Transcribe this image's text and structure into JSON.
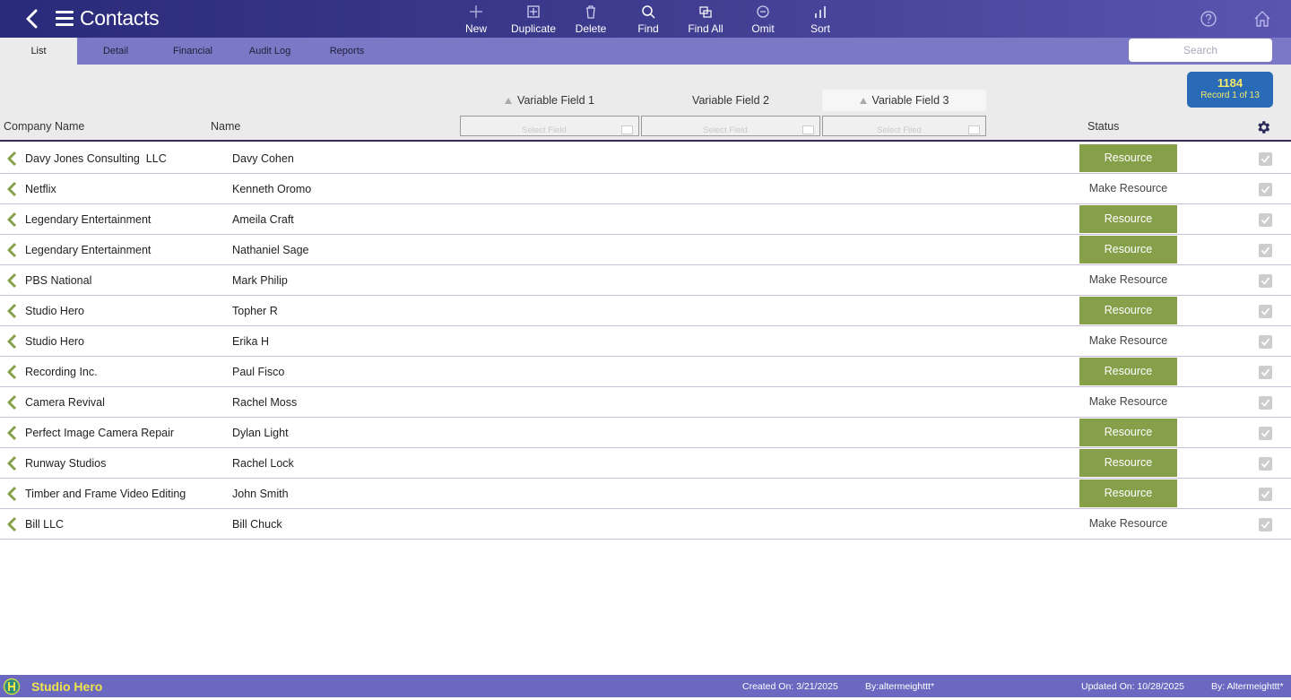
{
  "app": {
    "title": "Contacts",
    "icons": {
      "back": "chevron-left-icon",
      "menu": "hamburger-menu-icon",
      "help": "help-circle-icon",
      "home": "home-icon"
    }
  },
  "toolbar": {
    "new": "New",
    "duplicate": "Duplicate",
    "delete": "Delete",
    "find": "Find",
    "find_all": "Find All",
    "omit": "Omit",
    "sort": "Sort"
  },
  "tabs": [
    {
      "label": "List",
      "active": true
    },
    {
      "label": "Detail",
      "active": false
    },
    {
      "label": "Financial",
      "active": false
    },
    {
      "label": "Audit Log",
      "active": false
    },
    {
      "label": "Reports",
      "active": false
    }
  ],
  "search": {
    "placeholder": "Search"
  },
  "record_info": {
    "count": "1184",
    "position": "Record 1 of 13"
  },
  "variable_fields": [
    {
      "label": "Variable Field 1",
      "select_placeholder": "Select Field"
    },
    {
      "label": "Variable Field 2",
      "select_placeholder": "Select Field"
    },
    {
      "label": "Variable Field 3",
      "select_placeholder": "Select Filed"
    }
  ],
  "columns": {
    "company": "Company Name",
    "name": "Name",
    "status": "Status"
  },
  "rows": [
    {
      "company": "Davy Jones Consulting  LLC",
      "name": "Davy Cohen",
      "status": "Resource",
      "is_resource": true
    },
    {
      "company": "Netflix",
      "name": "Kenneth Oromo",
      "status": "Make Resource",
      "is_resource": false
    },
    {
      "company": "Legendary Entertainment",
      "name": "Ameila Craft",
      "status": "Resource",
      "is_resource": true
    },
    {
      "company": "Legendary Entertainment",
      "name": "Nathaniel Sage",
      "status": "Resource",
      "is_resource": true
    },
    {
      "company": "PBS National",
      "name": "Mark Philip",
      "status": "Make Resource",
      "is_resource": false
    },
    {
      "company": "Studio Hero",
      "name": "Topher R",
      "status": "Resource",
      "is_resource": true
    },
    {
      "company": "Studio Hero",
      "name": "Erika H",
      "status": "Make Resource",
      "is_resource": false
    },
    {
      "company": "Recording Inc.",
      "name": "Paul Fisco",
      "status": "Resource",
      "is_resource": true
    },
    {
      "company": "Camera Revival",
      "name": "Rachel Moss",
      "status": "Make Resource",
      "is_resource": false
    },
    {
      "company": "Perfect Image Camera Repair",
      "name": "Dylan Light",
      "status": "Resource",
      "is_resource": true
    },
    {
      "company": "Runway Studios",
      "name": "Rachel Lock",
      "status": "Resource",
      "is_resource": true
    },
    {
      "company": "Timber and Frame Video Editing",
      "name": "John Smith",
      "status": "Resource",
      "is_resource": true
    },
    {
      "company": "Bill LLC",
      "name": "Bill Chuck",
      "status": "Make Resource",
      "is_resource": false
    }
  ],
  "footer": {
    "org": "Studio Hero",
    "created_on": "Created On: 3/21/2025",
    "created_by": "By:altermeighttt*",
    "updated_on": "Updated On: 10/28/2025",
    "updated_by": "By: Altermeighttt*"
  },
  "colors": {
    "toolbar": "#3c3a8c",
    "tabbar": "#7b78c6",
    "resource_green": "#86a04a",
    "badge_blue": "#2a6bb8",
    "badge_text": "#f4e96a",
    "footer": "#6a68c0"
  }
}
